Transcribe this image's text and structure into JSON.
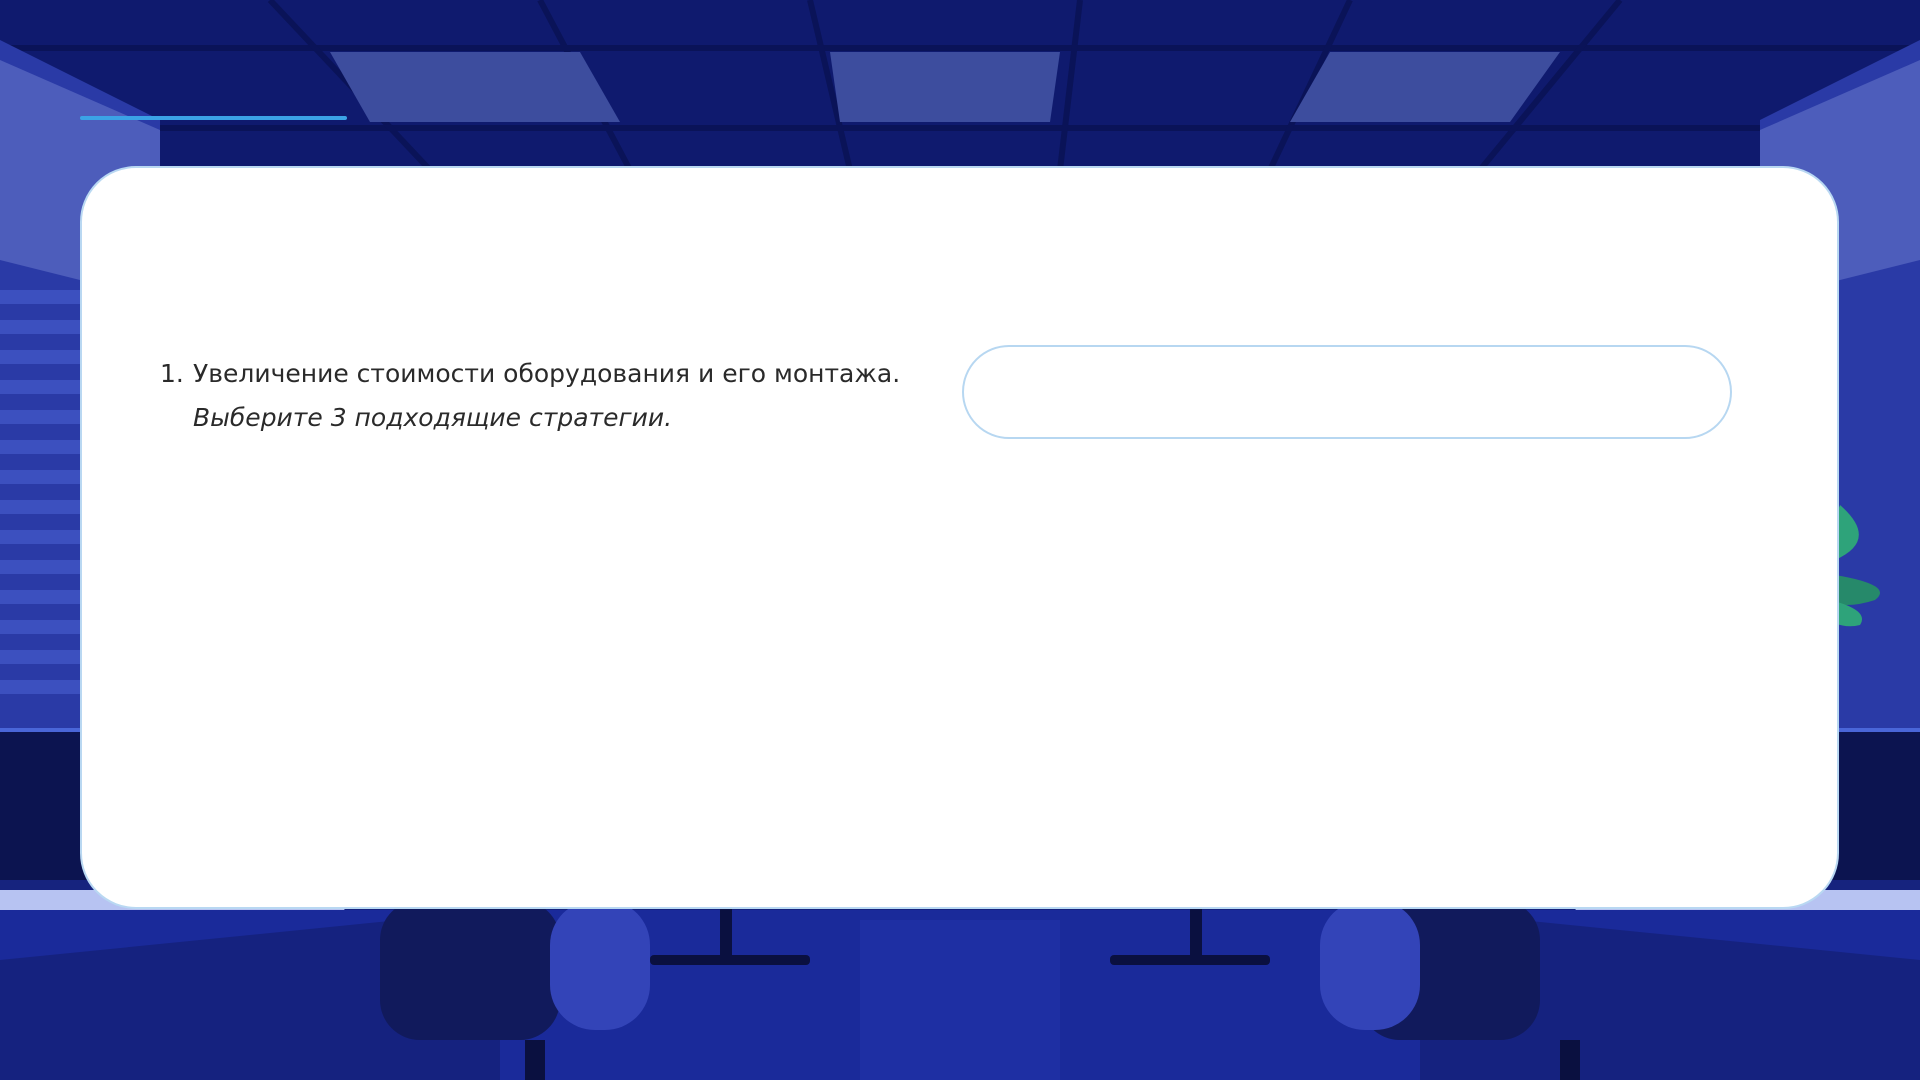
{
  "question": {
    "number": "1.",
    "text": "Увеличение стоимости оборудования и его монтажа.",
    "prompt": "Выберите 3 подходящие стратегии."
  },
  "answer": {
    "value": "",
    "placeholder": ""
  },
  "colors": {
    "background": "#16237e",
    "accent_line": "#3ba3e6",
    "card": "#ffffff",
    "card_border": "#b9d8f2"
  }
}
